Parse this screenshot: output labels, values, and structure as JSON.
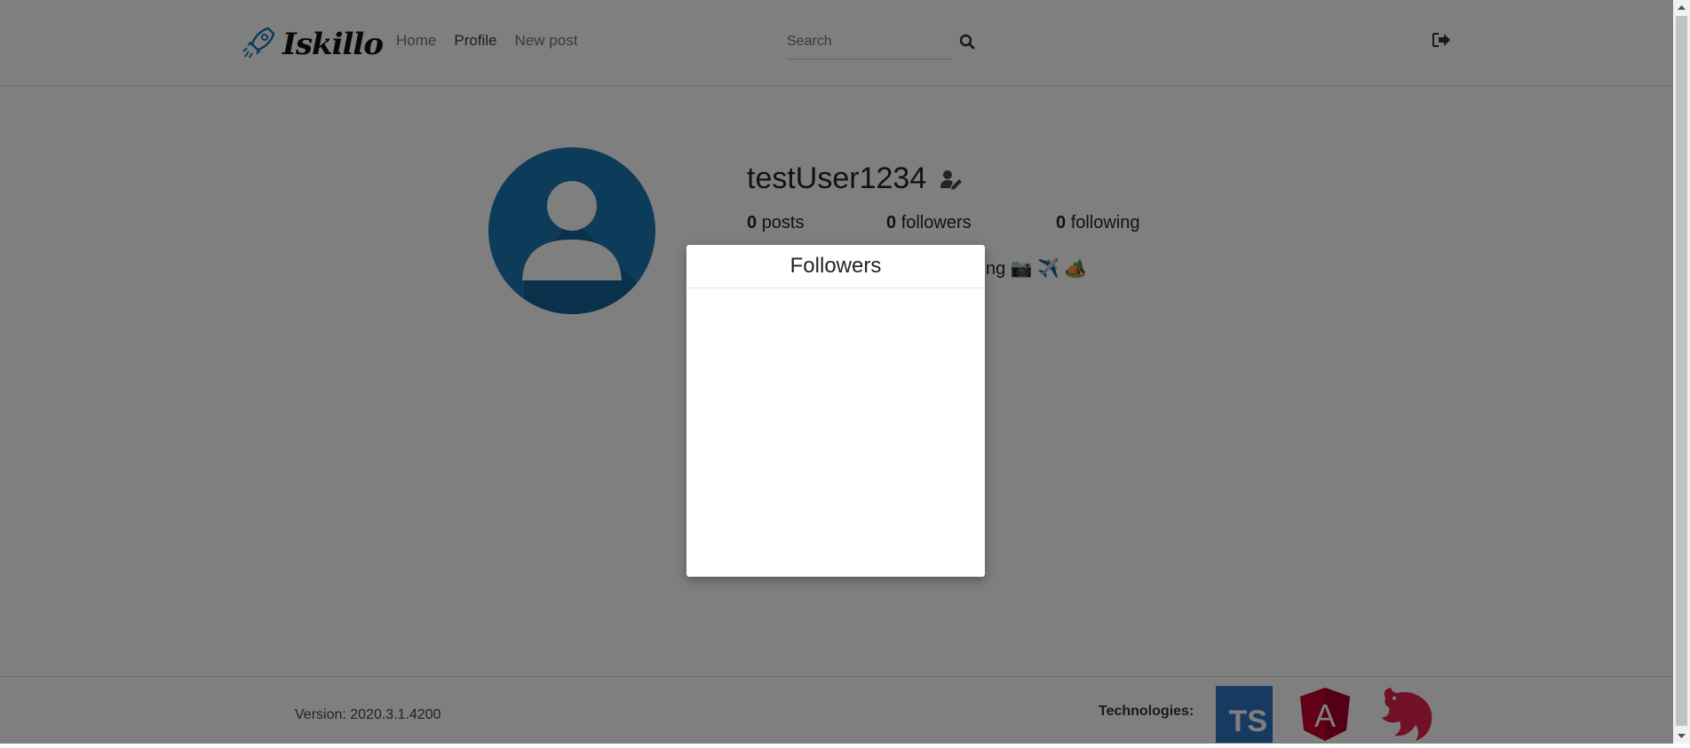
{
  "brand": {
    "name": "Iskillo",
    "icon": "rocket-icon",
    "accent": "#1a78b4"
  },
  "nav": {
    "items": [
      {
        "label": "Home",
        "active": false
      },
      {
        "label": "Profile",
        "active": true
      },
      {
        "label": "New post",
        "active": false
      }
    ]
  },
  "search": {
    "placeholder": "Search",
    "value": ""
  },
  "profile": {
    "username": "testUser1234",
    "stats": {
      "posts_count": "0",
      "posts_label": "posts",
      "followers_count": "0",
      "followers_label": "followers",
      "following_count": "0",
      "following_label": "following"
    },
    "bio": "sting 📷 ✈️ 🏕️"
  },
  "modal": {
    "title": "Followers"
  },
  "footer": {
    "version": "Version: 2020.3.1.4200",
    "technologies_label": "Technologies:",
    "technologies": [
      "TS",
      "A"
    ]
  }
}
